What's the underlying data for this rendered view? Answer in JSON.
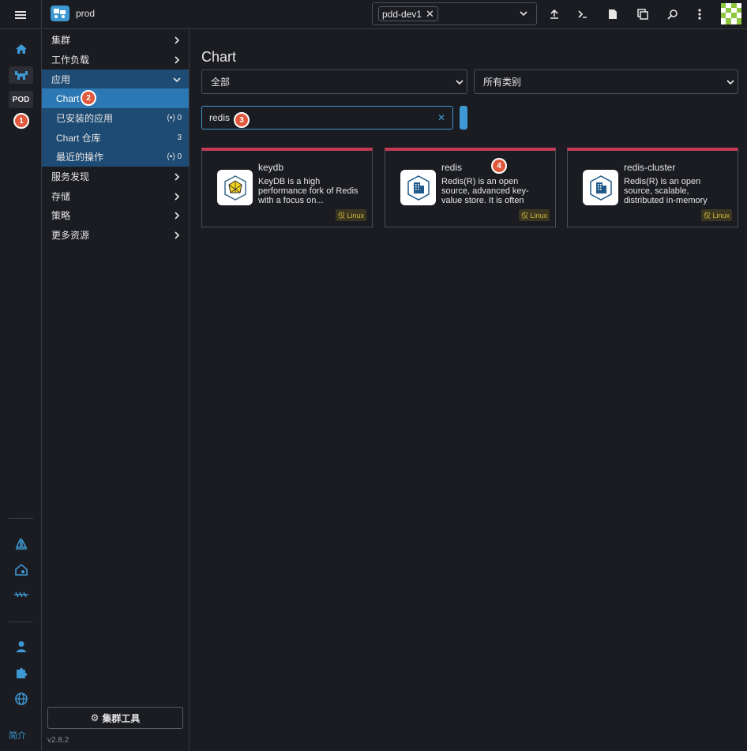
{
  "header": {
    "cluster_name": "prod",
    "namespace_chip": "pdd-dev1",
    "namespace_chip_close": "✕"
  },
  "rail": {
    "pod_badge": "POD",
    "footer_label": "简介"
  },
  "sidenav": {
    "groups": [
      {
        "label": "集群"
      },
      {
        "label": "工作负载"
      },
      {
        "label": "应用"
      },
      {
        "label": "服务发现"
      },
      {
        "label": "存储"
      },
      {
        "label": "策略"
      },
      {
        "label": "更多资源"
      }
    ],
    "app_items": [
      {
        "label": "Chart",
        "count": ""
      },
      {
        "label": "已安装的应用",
        "count": "0"
      },
      {
        "label": "Chart 仓库",
        "count": "3"
      },
      {
        "label": "最近的操作",
        "count": "0"
      }
    ],
    "cluster_tools": "集群工具",
    "version": "v2.8.2"
  },
  "main": {
    "title": "Chart",
    "repo_select": "全部",
    "category_select": "所有类别",
    "search_value": "redis",
    "cards": [
      {
        "name": "keydb",
        "description": "KeyDB is a high performance fork of Redis with a focus on...",
        "tag": "仅 Linux"
      },
      {
        "name": "redis",
        "description": "Redis(R) is an open source, advanced key-value store. It is often referred to as a da...",
        "tag": "仅 Linux"
      },
      {
        "name": "redis-cluster",
        "description": "Redis(R) is an open source, scalable, distributed in-memory cache for...",
        "tag": "仅 Linux"
      }
    ]
  },
  "markers": [
    "1",
    "2",
    "3",
    "4"
  ],
  "colors": {
    "accent": "#3d98d3",
    "card_top_border": "#c23a55",
    "marker": "#e0573c",
    "nav_open": "#1e4b73",
    "nav_active": "#2b78b4"
  }
}
